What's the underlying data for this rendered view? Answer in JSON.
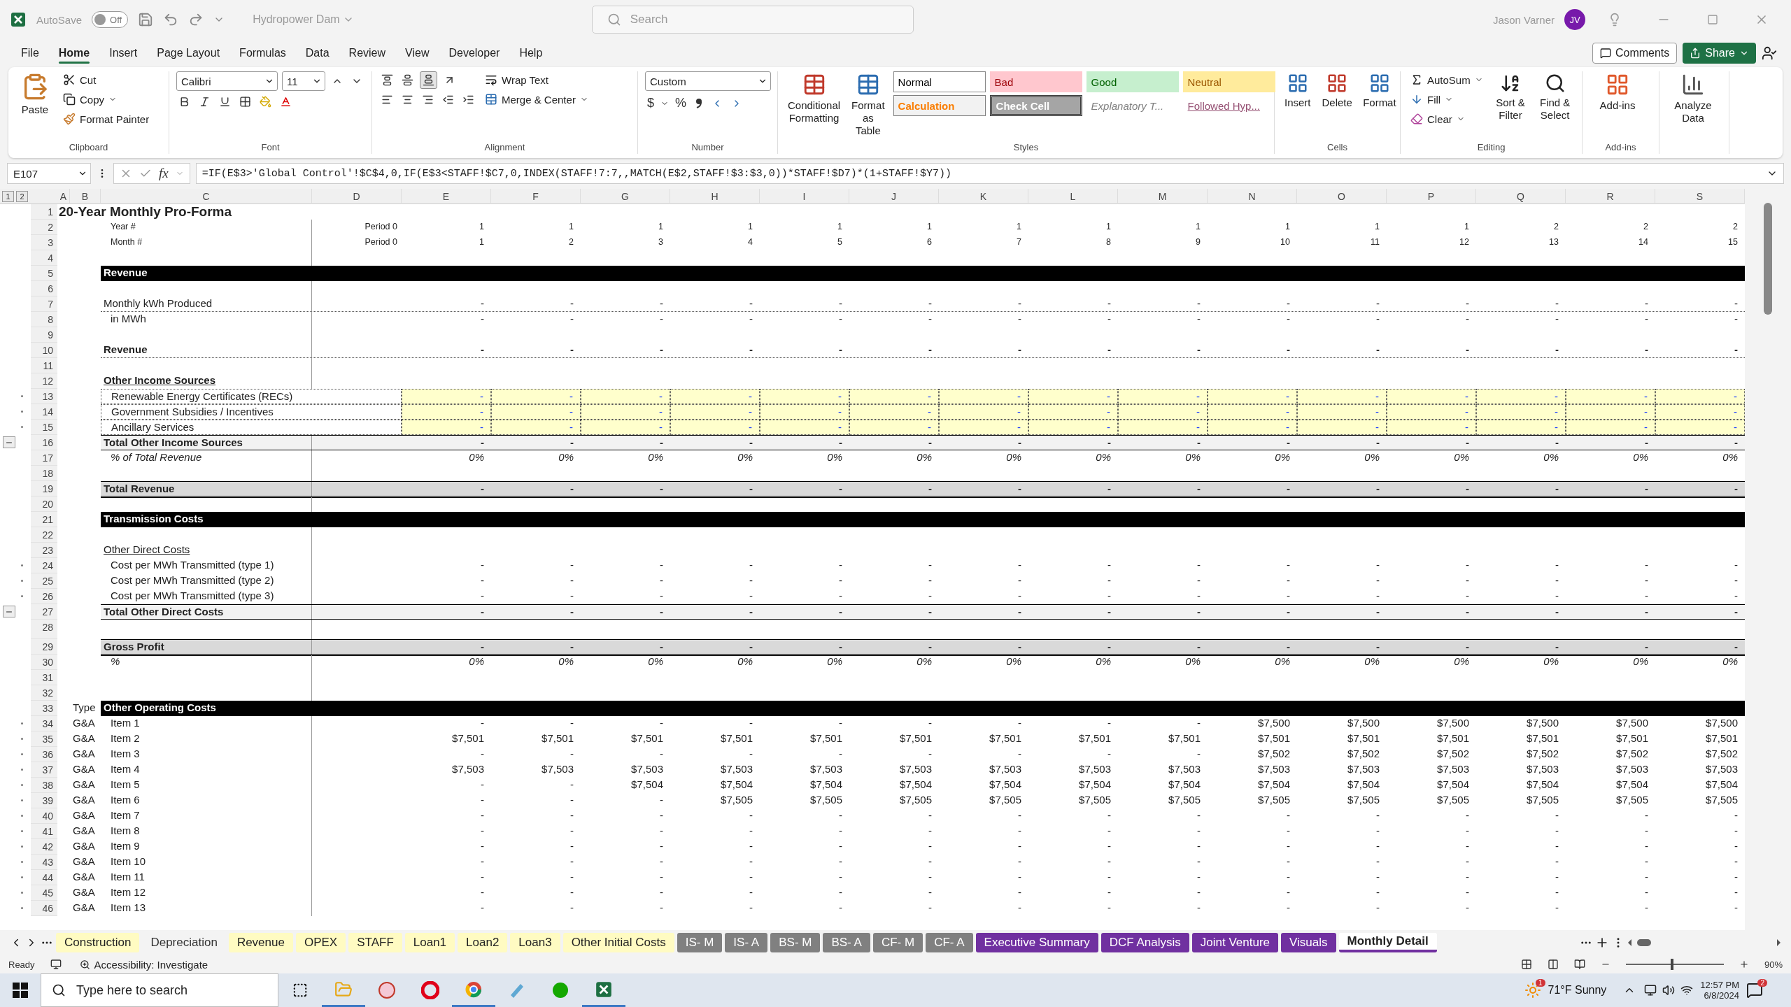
{
  "titlebar": {
    "autosave_label": "AutoSave",
    "autosave": {
      "on": false,
      "label": "Off"
    },
    "document": "Hydropower Dam",
    "search": {
      "placeholder": "Search"
    },
    "user": "Jason Varner",
    "initials": "JV"
  },
  "menu": [
    {
      "label": "File",
      "selected": false
    },
    {
      "label": "Home",
      "selected": true
    },
    {
      "label": "Insert",
      "selected": false
    },
    {
      "label": "Page Layout",
      "selected": false
    },
    {
      "label": "Formulas",
      "selected": false
    },
    {
      "label": "Data",
      "selected": false
    },
    {
      "label": "Review",
      "selected": false
    },
    {
      "label": "View",
      "selected": false
    },
    {
      "label": "Developer",
      "selected": false
    },
    {
      "label": "Help",
      "selected": false
    }
  ],
  "actions": {
    "comments": "Comments",
    "share": "Share"
  },
  "ribbon": {
    "clipboard": {
      "paste": "Paste",
      "cut": "Cut",
      "copy": "Copy",
      "format_painter": "Format Painter",
      "label": "Clipboard"
    },
    "font": {
      "name": "Calibri",
      "size": "11",
      "label": "Font"
    },
    "alignment": {
      "wrap": "Wrap Text",
      "merge": "Merge & Center",
      "label": "Alignment"
    },
    "number": {
      "format": "Custom",
      "currency": "$",
      "percent": "%",
      "label": "Number"
    },
    "styles": {
      "conditional": "Conditional Formatting",
      "table": "Format as Table",
      "label": "Styles",
      "cells": [
        {
          "label": "Normal",
          "kind": "normal"
        },
        {
          "label": "Bad",
          "kind": "bad"
        },
        {
          "label": "Good",
          "kind": "good"
        },
        {
          "label": "Neutral",
          "kind": "neutral"
        },
        {
          "label": "Calculation",
          "kind": "calculation"
        },
        {
          "label": "Check Cell",
          "kind": "check"
        },
        {
          "label": "Explanatory T...",
          "kind": "explanatory"
        },
        {
          "label": "Followed Hyp...",
          "kind": "followed"
        }
      ]
    },
    "cells": {
      "insert": "Insert",
      "delete": "Delete",
      "format": "Format",
      "label": "Cells"
    },
    "editing": {
      "autosum": "AutoSum",
      "fill": "Fill",
      "clear": "Clear",
      "sort": "Sort & Filter",
      "find": "Find & Select",
      "label": "Editing"
    },
    "addins": {
      "addins": "Add-ins",
      "analyze": "Analyze Data",
      "label": "Add-ins"
    }
  },
  "formula_bar": {
    "name_box": "E107",
    "fx": "fx",
    "formula": "=IF(E$3>'Global Control'!$C$4,0,IF(E$3<STAFF!$C7,0,INDEX(STAFF!7:7,,MATCH(E$2,STAFF!$3:$3,0))*STAFF!$D7)*(1+STAFF!$Y7))"
  },
  "sheet": {
    "outline_levels": [
      "1",
      "2"
    ],
    "columns": [
      "A",
      "B",
      "C",
      "D",
      "E",
      "F",
      "G",
      "H",
      "I",
      "J",
      "K",
      "L",
      "M",
      "N",
      "O",
      "P",
      "Q",
      "R",
      "S"
    ],
    "rows": [
      {
        "num": "1",
        "kind": "title",
        "label": "20-Year Monthly Pro-Forma"
      },
      {
        "num": "2",
        "kind": "period",
        "label": "Year #",
        "d": "Period 0",
        "values": [
          "1",
          "1",
          "1",
          "1",
          "1",
          "1",
          "1",
          "1",
          "1",
          "1",
          "1",
          "1",
          "2",
          "2",
          "2"
        ]
      },
      {
        "num": "3",
        "kind": "period",
        "label": "Month #",
        "d": "Period 0",
        "values": [
          "1",
          "2",
          "3",
          "4",
          "5",
          "6",
          "7",
          "8",
          "9",
          "10",
          "11",
          "12",
          "13",
          "14",
          "15"
        ]
      },
      {
        "num": "4",
        "kind": "blank"
      },
      {
        "num": "5",
        "kind": "section",
        "label": "Revenue"
      },
      {
        "num": "6",
        "kind": "blank"
      },
      {
        "num": "7",
        "kind": "line",
        "label": "Monthly kWh Produced",
        "values": [
          "-",
          "-",
          "-",
          "-",
          "-",
          "-",
          "-",
          "-",
          "-",
          "-",
          "-",
          "-",
          "-",
          "-",
          "-"
        ]
      },
      {
        "num": "8",
        "kind": "sub",
        "label": "in MWh",
        "values": [
          "-",
          "-",
          "-",
          "-",
          "-",
          "-",
          "-",
          "-",
          "-",
          "-",
          "-",
          "-",
          "-",
          "-",
          "-"
        ]
      },
      {
        "num": "9",
        "kind": "blank"
      },
      {
        "num": "10",
        "kind": "bold-line",
        "label": "Revenue",
        "values": [
          "-",
          "-",
          "-",
          "-",
          "-",
          "-",
          "-",
          "-",
          "-",
          "-",
          "-",
          "-",
          "-",
          "-",
          "-"
        ]
      },
      {
        "num": "11",
        "kind": "blank"
      },
      {
        "num": "12",
        "kind": "heading",
        "label": "Other Income Sources"
      },
      {
        "num": "13",
        "kind": "input",
        "grouped": true,
        "label": "Renewable Energy Certificates (RECs)",
        "values": [
          "-",
          "-",
          "-",
          "-",
          "-",
          "-",
          "-",
          "-",
          "-",
          "-",
          "-",
          "-",
          "-",
          "-",
          "-"
        ]
      },
      {
        "num": "14",
        "kind": "input",
        "grouped": true,
        "label": "Government Subsidies / Incentives",
        "values": [
          "-",
          "-",
          "-",
          "-",
          "-",
          "-",
          "-",
          "-",
          "-",
          "-",
          "-",
          "-",
          "-",
          "-",
          "-"
        ]
      },
      {
        "num": "15",
        "kind": "input",
        "grouped": true,
        "label": "Ancillary Services",
        "values": [
          "-",
          "-",
          "-",
          "-",
          "-",
          "-",
          "-",
          "-",
          "-",
          "-",
          "-",
          "-",
          "-",
          "-",
          "-"
        ]
      },
      {
        "num": "16",
        "kind": "subtotal",
        "group_end": true,
        "label": "Total Other Income Sources",
        "values": [
          "-",
          "-",
          "-",
          "-",
          "-",
          "-",
          "-",
          "-",
          "-",
          "-",
          "-",
          "-",
          "-",
          "-",
          "-"
        ]
      },
      {
        "num": "17",
        "kind": "percent",
        "label": "% of Total Revenue",
        "values": [
          "0%",
          "0%",
          "0%",
          "0%",
          "0%",
          "0%",
          "0%",
          "0%",
          "0%",
          "0%",
          "0%",
          "0%",
          "0%",
          "0%",
          "0%"
        ]
      },
      {
        "num": "18",
        "kind": "blank"
      },
      {
        "num": "19",
        "kind": "total",
        "label": "Total Revenue",
        "values": [
          "-",
          "-",
          "-",
          "-",
          "-",
          "-",
          "-",
          "-",
          "-",
          "-",
          "-",
          "-",
          "-",
          "-",
          "-"
        ]
      },
      {
        "num": "20",
        "kind": "blank"
      },
      {
        "num": "21",
        "kind": "section",
        "label": "Transmission Costs"
      },
      {
        "num": "22",
        "kind": "blank"
      },
      {
        "num": "23",
        "kind": "subheading",
        "label": "Other Direct Costs"
      },
      {
        "num": "24",
        "kind": "sub",
        "grouped": true,
        "label": "Cost per MWh Transmitted (type 1)",
        "values": [
          "-",
          "-",
          "-",
          "-",
          "-",
          "-",
          "-",
          "-",
          "-",
          "-",
          "-",
          "-",
          "-",
          "-",
          "-"
        ]
      },
      {
        "num": "25",
        "kind": "sub",
        "grouped": true,
        "label": "Cost per MWh Transmitted (type 2)",
        "values": [
          "-",
          "-",
          "-",
          "-",
          "-",
          "-",
          "-",
          "-",
          "-",
          "-",
          "-",
          "-",
          "-",
          "-",
          "-"
        ]
      },
      {
        "num": "26",
        "kind": "sub",
        "grouped": true,
        "label": "Cost per MWh Transmitted (type 3)",
        "values": [
          "-",
          "-",
          "-",
          "-",
          "-",
          "-",
          "-",
          "-",
          "-",
          "-",
          "-",
          "-",
          "-",
          "-",
          "-"
        ]
      },
      {
        "num": "27",
        "kind": "subtotal",
        "group_end": true,
        "label": "Total Other Direct Costs",
        "values": [
          "-",
          "-",
          "-",
          "-",
          "-",
          "-",
          "-",
          "-",
          "-",
          "-",
          "-",
          "-",
          "-",
          "-",
          "-"
        ]
      },
      {
        "num": "28",
        "kind": "tall"
      },
      {
        "num": "29",
        "kind": "total",
        "label": "Gross Profit",
        "values": [
          "-",
          "-",
          "-",
          "-",
          "-",
          "-",
          "-",
          "-",
          "-",
          "-",
          "-",
          "-",
          "-",
          "-",
          "-"
        ]
      },
      {
        "num": "30",
        "kind": "percent",
        "label": "%",
        "values": [
          "0%",
          "0%",
          "0%",
          "0%",
          "0%",
          "0%",
          "0%",
          "0%",
          "0%",
          "0%",
          "0%",
          "0%",
          "0%",
          "0%",
          "0%"
        ]
      },
      {
        "num": "31",
        "kind": "blank"
      },
      {
        "num": "32",
        "kind": "blank"
      },
      {
        "num": "33",
        "kind": "section",
        "type": "Type",
        "label": "Other Operating Costs"
      },
      {
        "num": "34",
        "kind": "item",
        "grouped": true,
        "type": "G&A",
        "label": "Item 1",
        "values": [
          "-",
          "-",
          "-",
          "-",
          "-",
          "-",
          "-",
          "-",
          "-",
          "$7,500",
          "$7,500",
          "$7,500",
          "$7,500",
          "$7,500",
          "$7,500"
        ]
      },
      {
        "num": "35",
        "kind": "item",
        "grouped": true,
        "type": "G&A",
        "label": "Item 2",
        "values": [
          "$7,501",
          "$7,501",
          "$7,501",
          "$7,501",
          "$7,501",
          "$7,501",
          "$7,501",
          "$7,501",
          "$7,501",
          "$7,501",
          "$7,501",
          "$7,501",
          "$7,501",
          "$7,501",
          "$7,501"
        ]
      },
      {
        "num": "36",
        "kind": "item",
        "grouped": true,
        "type": "G&A",
        "label": "Item 3",
        "values": [
          "-",
          "-",
          "-",
          "-",
          "-",
          "-",
          "-",
          "-",
          "-",
          "$7,502",
          "$7,502",
          "$7,502",
          "$7,502",
          "$7,502",
          "$7,502"
        ]
      },
      {
        "num": "37",
        "kind": "item",
        "grouped": true,
        "type": "G&A",
        "label": "Item 4",
        "values": [
          "$7,503",
          "$7,503",
          "$7,503",
          "$7,503",
          "$7,503",
          "$7,503",
          "$7,503",
          "$7,503",
          "$7,503",
          "$7,503",
          "$7,503",
          "$7,503",
          "$7,503",
          "$7,503",
          "$7,503"
        ]
      },
      {
        "num": "38",
        "kind": "item",
        "grouped": true,
        "type": "G&A",
        "label": "Item 5",
        "values": [
          "-",
          "-",
          "$7,504",
          "$7,504",
          "$7,504",
          "$7,504",
          "$7,504",
          "$7,504",
          "$7,504",
          "$7,504",
          "$7,504",
          "$7,504",
          "$7,504",
          "$7,504",
          "$7,504"
        ]
      },
      {
        "num": "39",
        "kind": "item",
        "grouped": true,
        "type": "G&A",
        "label": "Item 6",
        "values": [
          "-",
          "-",
          "-",
          "$7,505",
          "$7,505",
          "$7,505",
          "$7,505",
          "$7,505",
          "$7,505",
          "$7,505",
          "$7,505",
          "$7,505",
          "$7,505",
          "$7,505",
          "$7,505"
        ]
      },
      {
        "num": "40",
        "kind": "item",
        "grouped": true,
        "type": "G&A",
        "label": "Item 7",
        "values": [
          "-",
          "-",
          "-",
          "-",
          "-",
          "-",
          "-",
          "-",
          "-",
          "-",
          "-",
          "-",
          "-",
          "-",
          "-"
        ]
      },
      {
        "num": "41",
        "kind": "item",
        "grouped": true,
        "type": "G&A",
        "label": "Item 8",
        "values": [
          "-",
          "-",
          "-",
          "-",
          "-",
          "-",
          "-",
          "-",
          "-",
          "-",
          "-",
          "-",
          "-",
          "-",
          "-"
        ]
      },
      {
        "num": "42",
        "kind": "item",
        "grouped": true,
        "type": "G&A",
        "label": "Item 9",
        "values": [
          "-",
          "-",
          "-",
          "-",
          "-",
          "-",
          "-",
          "-",
          "-",
          "-",
          "-",
          "-",
          "-",
          "-",
          "-"
        ]
      },
      {
        "num": "43",
        "kind": "item",
        "grouped": true,
        "type": "G&A",
        "label": "Item 10",
        "values": [
          "-",
          "-",
          "-",
          "-",
          "-",
          "-",
          "-",
          "-",
          "-",
          "-",
          "-",
          "-",
          "-",
          "-",
          "-"
        ]
      },
      {
        "num": "44",
        "kind": "item",
        "grouped": true,
        "type": "G&A",
        "label": "Item 11",
        "values": [
          "-",
          "-",
          "-",
          "-",
          "-",
          "-",
          "-",
          "-",
          "-",
          "-",
          "-",
          "-",
          "-",
          "-",
          "-"
        ]
      },
      {
        "num": "45",
        "kind": "item",
        "grouped": true,
        "type": "G&A",
        "label": "Item 12",
        "values": [
          "-",
          "-",
          "-",
          "-",
          "-",
          "-",
          "-",
          "-",
          "-",
          "-",
          "-",
          "-",
          "-",
          "-",
          "-"
        ]
      },
      {
        "num": "46",
        "kind": "item",
        "grouped": true,
        "type": "G&A",
        "label": "Item 13",
        "values": [
          "-",
          "-",
          "-",
          "-",
          "-",
          "-",
          "-",
          "-",
          "-",
          "-",
          "-",
          "-",
          "-",
          "-",
          "-"
        ]
      }
    ]
  },
  "sheet_tabs": [
    {
      "label": "Construction",
      "color": "#fffbc2",
      "selected": false
    },
    {
      "label": "Depreciation",
      "selected": false
    },
    {
      "label": "Revenue",
      "color": "#fffbc2",
      "selected": false
    },
    {
      "label": "OPEX",
      "color": "#fffbc2",
      "selected": false
    },
    {
      "label": "STAFF",
      "color": "#fffbc2",
      "selected": false
    },
    {
      "label": "Loan1",
      "color": "#fffbc2",
      "selected": false
    },
    {
      "label": "Loan2",
      "color": "#fffbc2",
      "selected": false
    },
    {
      "label": "Loan3",
      "color": "#fffbc2",
      "selected": false
    },
    {
      "label": "Other Initial Costs",
      "color": "#fffbc2",
      "selected": false
    },
    {
      "label": "IS- M",
      "color": "#808080",
      "selected": false
    },
    {
      "label": "IS- A",
      "color": "#808080",
      "selected": false
    },
    {
      "label": "BS- M",
      "color": "#808080",
      "selected": false
    },
    {
      "label": "BS- A",
      "color": "#808080",
      "selected": false
    },
    {
      "label": "CF- M",
      "color": "#808080",
      "selected": false
    },
    {
      "label": "CF- A",
      "color": "#808080",
      "selected": false
    },
    {
      "label": "Executive Summary",
      "color": "#7030a0",
      "selected": false
    },
    {
      "label": "DCF Analysis",
      "color": "#7030a0",
      "selected": false
    },
    {
      "label": "Joint Venture",
      "color": "#7030a0",
      "selected": false
    },
    {
      "label": "Visuals",
      "color": "#7030a0",
      "selected": false
    },
    {
      "label": "Monthly Detail",
      "color": "#7030a0",
      "selected": true
    }
  ],
  "status_bar": {
    "mode": "Ready",
    "accessibility": "Accessibility: Investigate",
    "zoom_slider": {
      "level": 0.47
    },
    "zoom": "90%"
  },
  "taskbar": {
    "search": {
      "placeholder": "Type here to search"
    },
    "weather_badge": "1",
    "weather": "71°F  Sunny",
    "time": "12:57 PM",
    "date": "6/8/2024",
    "notifications": "2"
  }
}
